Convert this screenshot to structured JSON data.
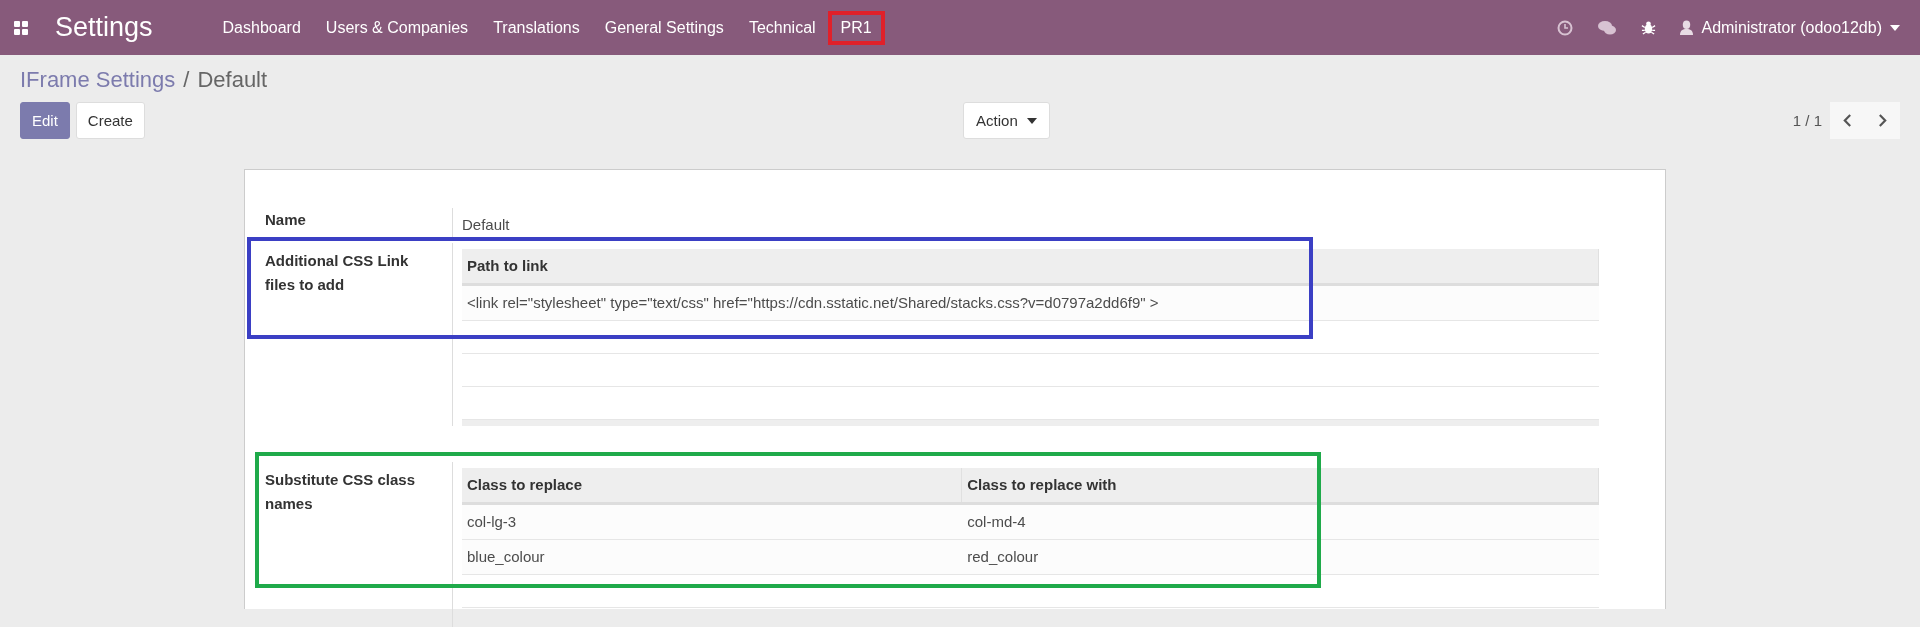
{
  "navbar": {
    "app_title": "Settings",
    "menu": [
      {
        "label": "Dashboard"
      },
      {
        "label": "Users & Companies"
      },
      {
        "label": "Translations"
      },
      {
        "label": "General Settings"
      },
      {
        "label": "Technical"
      },
      {
        "label": "PR1",
        "color": "#e0202a"
      }
    ],
    "user": "Administrator (odoo12db)"
  },
  "breadcrumb": {
    "parent": "IFrame Settings",
    "separator": "/",
    "current": "Default"
  },
  "buttons": {
    "edit": "Edit",
    "create": "Create",
    "action": "Action"
  },
  "pager": {
    "value": "1 / 1"
  },
  "form": {
    "fields": [
      {
        "kind": "text",
        "label": "Name",
        "value": "Default"
      },
      {
        "kind": "table",
        "label": "Additional CSS Link files to add",
        "color": "#3b3fc4",
        "columns": [
          "Path to link"
        ],
        "rows": [
          [
            "<link rel=\"stylesheet\" type=\"text/css\" href=\"https://cdn.sstatic.net/Shared/stacks.css?v=d0797a2dd6f9\" >"
          ]
        ]
      },
      {
        "kind": "table",
        "label": "Substitute CSS class names",
        "color": "#1faa4a",
        "columns": [
          "Class to replace",
          "Class to replace with"
        ],
        "rows": [
          [
            "col-lg-3",
            "col-md-4"
          ],
          [
            "blue_colour",
            "red_colour"
          ]
        ]
      }
    ]
  }
}
